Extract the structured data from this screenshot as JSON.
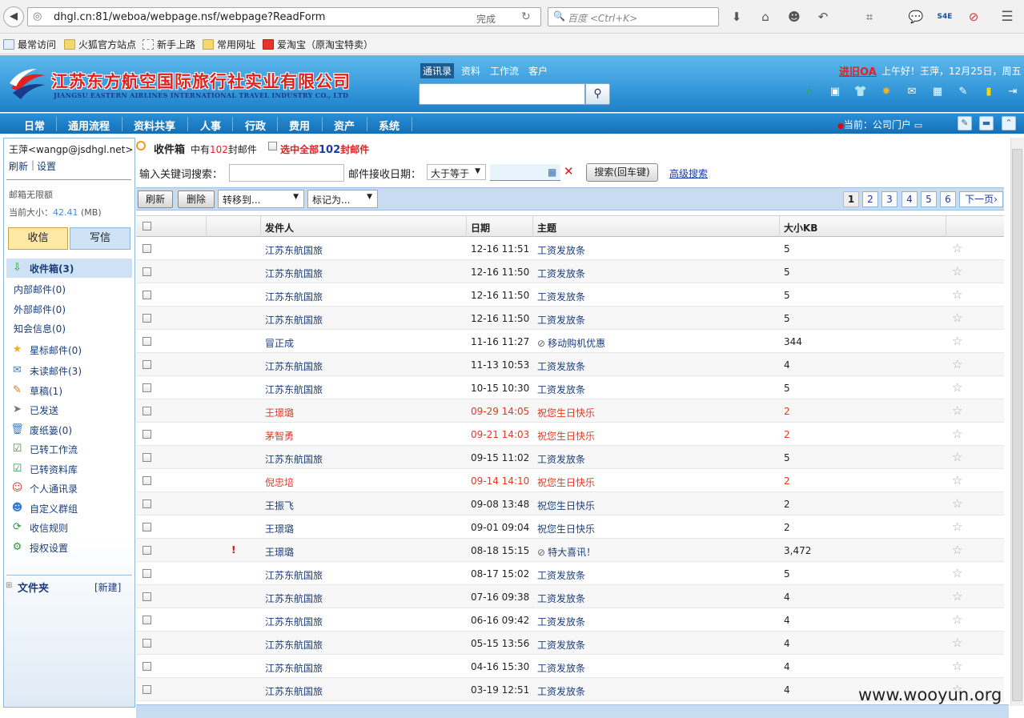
{
  "browser": {
    "url": "dhgl.cn:81/weboa/webpage.nsf/webpage?ReadForm",
    "status": "完成",
    "search_placeholder": "百度 <Ctrl+K>",
    "bookmarks": [
      "最常访问",
      "火狐官方站点",
      "新手上路",
      "常用网址",
      "爱淘宝（原淘宝特卖）"
    ]
  },
  "header": {
    "company_cn": "江苏东方航空国际旅行社实业有限公司",
    "company_en": "JIANGSU EASTERN AIRLINES INTERNATIONAL TRAVEL INDUSTRY CO., LTD",
    "tabs": [
      "通讯录",
      "资料",
      "工作流",
      "客户"
    ],
    "old_system": "进旧OA",
    "greeting": "上午好！王萍，12月25日，周五"
  },
  "main_nav": {
    "items": [
      "日常",
      "通用流程",
      "资料共享",
      "人事",
      "行政",
      "费用",
      "资产",
      "系统"
    ],
    "current": "当前：公司门户"
  },
  "sidebar": {
    "user": "王萍<wangp@jsdhgl.net>",
    "refresh": "刷新",
    "settings": "设置",
    "quota": "邮箱无限额",
    "size_label": "当前大小：",
    "size_value": "42.41",
    "size_unit": "(MB)",
    "recv": "收信",
    "write": "写信",
    "inbox": "收件箱(3)",
    "items": [
      {
        "label": "内部邮件(0)",
        "icon": ""
      },
      {
        "label": "外部邮件(0)",
        "icon": ""
      },
      {
        "label": "知会信息(0)",
        "icon": ""
      },
      {
        "label": "星标邮件(0)",
        "icon": "star-icon"
      },
      {
        "label": "未读邮件(3)",
        "icon": "unread-icon"
      },
      {
        "label": "草稿(1)",
        "icon": "draft-icon"
      },
      {
        "label": "已发送",
        "icon": "sent-icon"
      },
      {
        "label": "废纸篓(0)",
        "icon": "trash-icon"
      },
      {
        "label": "已转工作流",
        "icon": "workflow-icon"
      },
      {
        "label": "已转资料库",
        "icon": "library-icon"
      },
      {
        "label": "个人通讯录",
        "icon": "contacts-icon"
      },
      {
        "label": "自定义群组",
        "icon": "group-icon"
      },
      {
        "label": "收信规则",
        "icon": "rules-icon"
      },
      {
        "label": "授权设置",
        "icon": "auth-icon"
      }
    ],
    "folder": "文件夹",
    "folder_new": "[新建]"
  },
  "inbox": {
    "title": "收件箱",
    "count_pre": "中有",
    "count": "102",
    "count_post": "封邮件",
    "selall_pre": "选中全部",
    "selall_num": "102",
    "selall_post": "封邮件",
    "kw_label": "输入关键词搜索：",
    "date_label": "邮件接收日期：",
    "date_op": "大于等于",
    "search_btn": "搜索(回车键)",
    "adv_search": "高级搜索",
    "refresh_btn": "刷新",
    "delete_btn": "删除",
    "move_to": "转移到...",
    "mark_as": "标记为...",
    "pages": [
      "1",
      "2",
      "3",
      "4",
      "5",
      "6"
    ],
    "next_page": "下一页",
    "columns": {
      "sender": "发件人",
      "date": "日期",
      "subject": "主题",
      "size": "大小KB"
    },
    "rows": [
      {
        "sender": "江苏东航国旅",
        "date": "12-16 11:51",
        "subject": "工资发放条",
        "size": "5",
        "hl": false,
        "attach": false,
        "pri": false
      },
      {
        "sender": "江苏东航国旅",
        "date": "12-16 11:50",
        "subject": "工资发放条",
        "size": "5",
        "hl": false,
        "attach": false,
        "pri": false
      },
      {
        "sender": "江苏东航国旅",
        "date": "12-16 11:50",
        "subject": "工资发放条",
        "size": "5",
        "hl": false,
        "attach": false,
        "pri": false
      },
      {
        "sender": "江苏东航国旅",
        "date": "12-16 11:50",
        "subject": "工资发放条",
        "size": "5",
        "hl": false,
        "attach": false,
        "pri": false
      },
      {
        "sender": "冒正成",
        "date": "11-16 11:27",
        "subject": "移动购机优惠",
        "size": "344",
        "hl": false,
        "attach": true,
        "pri": false
      },
      {
        "sender": "江苏东航国旅",
        "date": "11-13 10:53",
        "subject": "工资发放条",
        "size": "4",
        "hl": false,
        "attach": false,
        "pri": false
      },
      {
        "sender": "江苏东航国旅",
        "date": "10-15 10:30",
        "subject": "工资发放条",
        "size": "5",
        "hl": false,
        "attach": false,
        "pri": false
      },
      {
        "sender": "王璟璐",
        "date": "09-29 14:05",
        "subject": "祝您生日快乐",
        "size": "2",
        "hl": true,
        "attach": false,
        "pri": false
      },
      {
        "sender": "茅智勇",
        "date": "09-21 14:03",
        "subject": "祝您生日快乐",
        "size": "2",
        "hl": true,
        "attach": false,
        "pri": false
      },
      {
        "sender": "江苏东航国旅",
        "date": "09-15 11:02",
        "subject": "工资发放条",
        "size": "5",
        "hl": false,
        "attach": false,
        "pri": false
      },
      {
        "sender": "倪忠培",
        "date": "09-14 14:10",
        "subject": "祝您生日快乐",
        "size": "2",
        "hl": true,
        "attach": false,
        "pri": false
      },
      {
        "sender": "王振飞",
        "date": "09-08 13:48",
        "subject": "祝您生日快乐",
        "size": "2",
        "hl": false,
        "attach": false,
        "pri": false
      },
      {
        "sender": "王璟璐",
        "date": "09-01 09:04",
        "subject": "祝您生日快乐",
        "size": "2",
        "hl": false,
        "attach": false,
        "pri": false
      },
      {
        "sender": "王璟璐",
        "date": "08-18 15:15",
        "subject": "特大喜讯！",
        "size": "3,472",
        "hl": false,
        "attach": true,
        "pri": true
      },
      {
        "sender": "江苏东航国旅",
        "date": "08-17 15:02",
        "subject": "工资发放条",
        "size": "5",
        "hl": false,
        "attach": false,
        "pri": false
      },
      {
        "sender": "江苏东航国旅",
        "date": "07-16 09:38",
        "subject": "工资发放条",
        "size": "4",
        "hl": false,
        "attach": false,
        "pri": false
      },
      {
        "sender": "江苏东航国旅",
        "date": "06-16 09:42",
        "subject": "工资发放条",
        "size": "4",
        "hl": false,
        "attach": false,
        "pri": false
      },
      {
        "sender": "江苏东航国旅",
        "date": "05-15 13:56",
        "subject": "工资发放条",
        "size": "4",
        "hl": false,
        "attach": false,
        "pri": false
      },
      {
        "sender": "江苏东航国旅",
        "date": "04-16 15:30",
        "subject": "工资发放条",
        "size": "4",
        "hl": false,
        "attach": false,
        "pri": false
      },
      {
        "sender": "江苏东航国旅",
        "date": "03-19 12:51",
        "subject": "工资发放条",
        "size": "4",
        "hl": false,
        "attach": false,
        "pri": false
      }
    ]
  },
  "watermark": "www.wooyun.org"
}
